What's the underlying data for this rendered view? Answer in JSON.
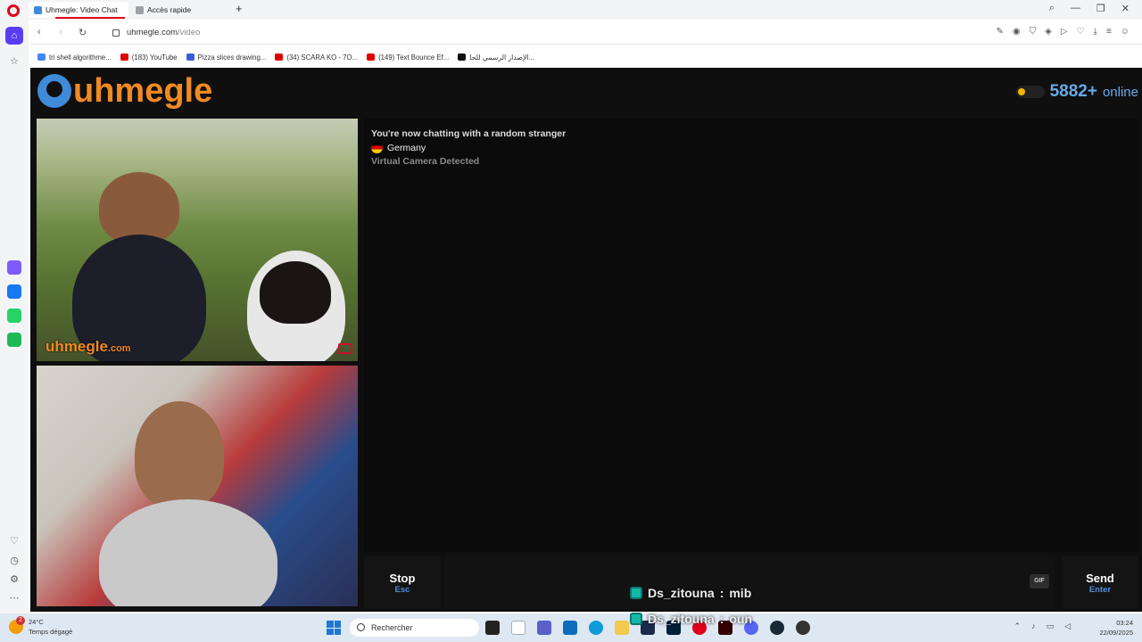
{
  "browser": {
    "tabs": [
      {
        "label": "Uhmegle: Video Chat",
        "active": true
      },
      {
        "label": "Accès rapide",
        "active": false
      }
    ],
    "new_tab": "+",
    "url_domain": "uhmegle.com",
    "url_path": "/video",
    "bookmarks": [
      {
        "label": "tri shell algorithme...",
        "color": "#4285f4"
      },
      {
        "label": "(183) YouTube",
        "color": "#e00000"
      },
      {
        "label": "Pizza slices drawing...",
        "color": "#3b5bdb"
      },
      {
        "label": "(34) SCARA KO - 7O...",
        "color": "#e00000"
      },
      {
        "label": "(149) Text Bounce Ef...",
        "color": "#e00000"
      },
      {
        "label": "الإصدار الرسمي للحا...",
        "color": "#111111"
      }
    ]
  },
  "site": {
    "logo_text": "uhmegle",
    "online_count": "5882+",
    "online_label": "online",
    "chat": {
      "status": "You're now chatting with a random stranger",
      "country": "Germany",
      "warning": "Virtual Camera Detected"
    },
    "watermark_main": "uhmegle",
    "watermark_suffix": ".com",
    "stop_label": "Stop",
    "stop_key": "Esc",
    "gif_label": "GIF",
    "send_label": "Send",
    "send_key": "Enter",
    "accent": "#f08a24",
    "brand_blue": "#3f8bd9"
  },
  "overlay": [
    {
      "user": "Ds_zitouna",
      "message": "mib"
    },
    {
      "user": "Ds_zitouna",
      "message": "oun"
    }
  ],
  "taskbar": {
    "weather_badge": "2",
    "temperature": "24°C",
    "weather_desc": "Temps dégagé",
    "search_placeholder": "Rechercher",
    "time": "03:24",
    "date": "22/09/2025"
  }
}
